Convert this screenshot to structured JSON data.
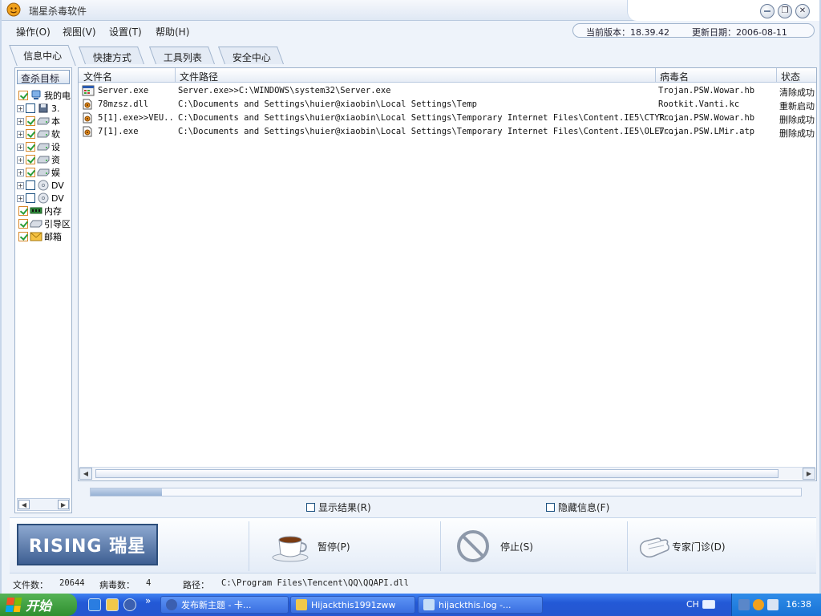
{
  "window": {
    "title": "瑞星杀毒软件",
    "controls": {
      "minimize": "–",
      "restore": "❐",
      "close": "✕"
    }
  },
  "menu": [
    {
      "label": "操作(O)"
    },
    {
      "label": "视图(V)"
    },
    {
      "label": "设置(T)"
    },
    {
      "label": "帮助(H)"
    }
  ],
  "version": {
    "current_label": "当前版本：18.39.42",
    "update_label": "更新日期：2006-08-11"
  },
  "tabs": [
    {
      "label": "信息中心",
      "active": true
    },
    {
      "label": "快捷方式",
      "active": false
    },
    {
      "label": "工具列表",
      "active": false
    },
    {
      "label": "安全中心",
      "active": false
    }
  ],
  "left_panel": {
    "header": "查杀目标",
    "tree": [
      {
        "label": "我的电",
        "checkbox": "checked",
        "expander": false,
        "icon": "computer-icon"
      },
      {
        "label": "3.",
        "checkbox": "unchecked",
        "expander": true,
        "icon": "floppy-icon"
      },
      {
        "label": "本",
        "checkbox": "checked",
        "expander": true,
        "icon": "drive-icon"
      },
      {
        "label": "软",
        "checkbox": "checked",
        "expander": true,
        "icon": "drive-icon"
      },
      {
        "label": "设",
        "checkbox": "checked",
        "expander": true,
        "icon": "drive-icon"
      },
      {
        "label": "资",
        "checkbox": "checked",
        "expander": true,
        "icon": "drive-icon"
      },
      {
        "label": "娱",
        "checkbox": "checked",
        "expander": true,
        "icon": "drive-icon"
      },
      {
        "label": "DV",
        "checkbox": "unchecked",
        "expander": true,
        "icon": "cd-icon"
      },
      {
        "label": "DV",
        "checkbox": "unchecked",
        "expander": true,
        "icon": "cd-icon"
      },
      {
        "label": "内存",
        "checkbox": "checked",
        "expander": false,
        "icon": "memory-icon"
      },
      {
        "label": "引导区",
        "checkbox": "checked",
        "expander": false,
        "icon": "boot-icon"
      },
      {
        "label": "邮箱",
        "checkbox": "checked",
        "expander": false,
        "icon": "mail-icon"
      }
    ]
  },
  "table": {
    "columns": [
      "文件名",
      "文件路径",
      "病毒名",
      "状态"
    ],
    "rows": [
      {
        "icon": "exe-icon",
        "name": "Server.exe",
        "path": "Server.exe>>C:\\WINDOWS\\system32\\Server.exe",
        "virus": "Trojan.PSW.Wowar.hb",
        "state": "清除成功"
      },
      {
        "icon": "virus-file-icon",
        "name": "78mzsz.dll",
        "path": "C:\\Documents and Settings\\huier@xiaobin\\Local Settings\\Temp",
        "virus": "Rootkit.Vanti.kc",
        "state": "重新启动"
      },
      {
        "icon": "virus-file-icon",
        "name": "5[1].exe>>VEU...",
        "path": "C:\\Documents and Settings\\huier@xiaobin\\Local Settings\\Temporary Internet Files\\Content.IE5\\CTYR...",
        "virus": "Trojan.PSW.Wowar.hb",
        "state": "删除成功"
      },
      {
        "icon": "virus-file-icon",
        "name": "7[1].exe",
        "path": "C:\\Documents and Settings\\huier@xiaobin\\Local Settings\\Temporary Internet Files\\Content.IE5\\OLE7...",
        "virus": "Trojan.PSW.LMir.atp",
        "state": "删除成功"
      }
    ]
  },
  "progress": {
    "percent": 10
  },
  "options": {
    "show_results": "显示结果(R)",
    "hide_info": "隐藏信息(F)"
  },
  "actions": {
    "logo_text": "RISING 瑞星",
    "pause": "暂停(P)",
    "stop": "停止(S)",
    "expert": "专家门诊(D)"
  },
  "status": {
    "files_label": "文件数：",
    "files_value": "20644",
    "virus_label": "病毒数：",
    "virus_value": "4",
    "path_label": "路径：",
    "path_value": "C:\\Program Files\\Tencent\\QQ\\QQAPI.dll"
  },
  "taskbar": {
    "start": "开始",
    "chevron": "»",
    "buttons": [
      {
        "label": "发布新主题 - 卡...",
        "icon": "maxthon-icon"
      },
      {
        "label": "Hijackthis1991zww",
        "icon": "folder-icon"
      },
      {
        "label": "hijackthis.log -...",
        "icon": "notepad-icon"
      }
    ],
    "lang": "CH",
    "clock": "16:38"
  }
}
